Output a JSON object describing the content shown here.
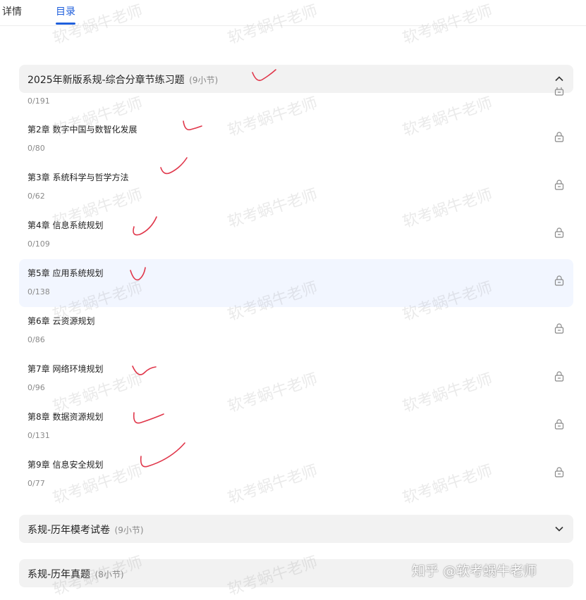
{
  "tabs": [
    {
      "label": "详情"
    },
    {
      "label": "目录"
    }
  ],
  "sections": [
    {
      "title": "2025年新版系规-综合分章节练习题",
      "count": "(9小节)",
      "expanded": true
    },
    {
      "title": "系规-历年模考试卷",
      "count": "(9小节)",
      "expanded": false
    },
    {
      "title": "系规-历年真题",
      "count": "(8小节)",
      "expanded": false
    }
  ],
  "first_item_progress": "0/191",
  "items": [
    {
      "title": "第2章 数字中国与数智化发展",
      "progress": "0/80"
    },
    {
      "title": "第3章 系统科学与哲学方法",
      "progress": "0/62"
    },
    {
      "title": "第4章 信息系统规划",
      "progress": "0/109"
    },
    {
      "title": "第5章 应用系统规划",
      "progress": "0/138"
    },
    {
      "title": "第6章 云资源规划",
      "progress": "0/86"
    },
    {
      "title": "第7章 网络环境规划",
      "progress": "0/96"
    },
    {
      "title": "第8章 数据资源规划",
      "progress": "0/131"
    },
    {
      "title": "第9章 信息安全规划",
      "progress": "0/77"
    }
  ],
  "watermark": {
    "text": "软考蜗牛老师"
  },
  "footer_watermark": "知乎 @软考蜗牛老师",
  "colors": {
    "accent": "#1f5fdc",
    "active_row": "#f2f6ff",
    "ink": "#e0364a"
  },
  "icons": {
    "collapse": "chevron-up-icon",
    "expand": "chevron-down-icon",
    "item": "lock-icon"
  }
}
